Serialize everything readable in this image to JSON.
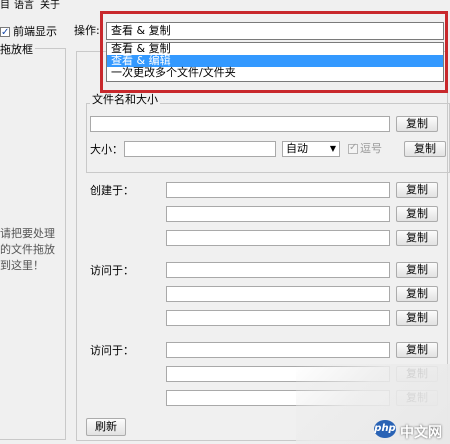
{
  "menu": [
    "目",
    "语言",
    "关于"
  ],
  "topmost": {
    "label": "前端显示",
    "checked": true
  },
  "left_panel": {
    "title": "拖放框",
    "hint_lines": [
      "请把要处理",
      "的文件拖放",
      "到这里！"
    ]
  },
  "operation": {
    "label": "操作:",
    "selected": "查看 & 复制",
    "options": [
      "查看 & 复制",
      "查看 & 编辑",
      "一次更改多个文件/文件夹"
    ],
    "highlighted_index": 1
  },
  "name_size": {
    "title": "文件名和大小",
    "filename_value": "",
    "copy_label": "复制",
    "size_label": "大小：",
    "size_value": "",
    "unit_selected": "自动",
    "comma": {
      "label": "逗号",
      "checked": true,
      "enabled": false
    },
    "size_copy_label": "复制"
  },
  "created": {
    "label": "创建于：",
    "copy_labels": [
      "复制",
      "复制",
      "复制"
    ]
  },
  "accessed": {
    "label": "访问于：",
    "copy_labels": [
      "复制",
      "复制",
      "复制"
    ]
  },
  "modified": {
    "label": "访问于：",
    "copy_labels": [
      "复制",
      "复制",
      "复制"
    ]
  },
  "refresh_label": "刷新",
  "watermark": {
    "logo": "php",
    "text": "中文网"
  }
}
